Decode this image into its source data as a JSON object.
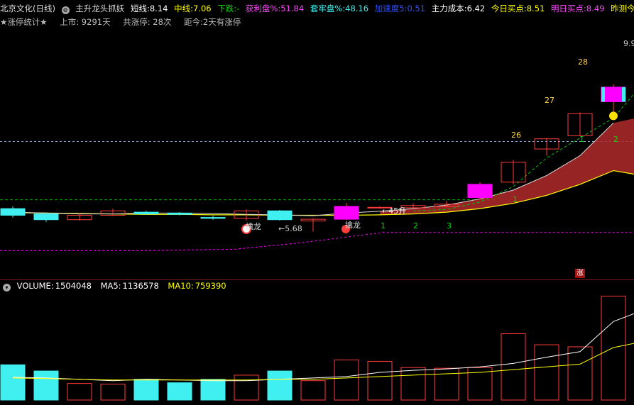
{
  "header": {
    "title": "北京文化(日线)",
    "indicator_name": "主升龙头抓妖",
    "short_label": "短线:",
    "short_value": "8.14",
    "mid_label": "中线:",
    "mid_value": "7.06",
    "fall_label": "下跌:",
    "fall_value": "-",
    "profit_label": "获利盘%:",
    "profit_value": "51.84",
    "trapped_label": "套牢盘%:",
    "trapped_value": "48.16",
    "accel_label": "加速度5:",
    "accel_value": "0.51",
    "cost_label": "主力成本:",
    "cost_value": "6.42",
    "today_buy_label": "今日买点:",
    "today_buy_value": "8.51",
    "tomorrow_buy_label": "明日买点:",
    "tomorrow_buy_value": "8.49",
    "yesterday_label": "昨测今日"
  },
  "stats": {
    "title": "★涨停统计★",
    "listed": "上市: 9291天",
    "limit_total": "共涨停: 28次",
    "since": "距今:2天有涨停"
  },
  "chart_labels": {
    "dragon1": "擒龙",
    "dragon2": "擒龙",
    "low_marker": "←5.68",
    "count_marker": "←45升",
    "top_marker": "9.9",
    "zhang": "涨",
    "waves": [
      "1",
      "2",
      "3",
      "1",
      "1",
      "2"
    ],
    "counts": [
      "26",
      "27",
      "28"
    ]
  },
  "volume": {
    "label": "VOLUME:",
    "value": "1504048",
    "ma5_label": "MA5:",
    "ma5_value": "1136578",
    "ma10_label": "MA10:",
    "ma10_value": "759390"
  },
  "colors": {
    "up": "#ff3b3b",
    "down": "#40f0f0",
    "magenta": "#ff00ff",
    "yellow": "#ffff00",
    "green": "#00e000",
    "fill": "#b02a2a"
  },
  "chart_data": {
    "type": "candlestick",
    "candles": [
      {
        "o": 6.2,
        "c": 6.05,
        "h": 6.25,
        "l": 6.0,
        "dir": "down"
      },
      {
        "o": 6.08,
        "c": 5.95,
        "h": 6.1,
        "l": 5.9,
        "dir": "down"
      },
      {
        "o": 5.95,
        "c": 6.05,
        "h": 6.1,
        "l": 5.93,
        "dir": "up"
      },
      {
        "o": 6.05,
        "c": 6.15,
        "h": 6.2,
        "l": 6.03,
        "dir": "up"
      },
      {
        "o": 6.12,
        "c": 6.08,
        "h": 6.15,
        "l": 6.06,
        "dir": "down"
      },
      {
        "o": 6.1,
        "c": 6.07,
        "h": 6.12,
        "l": 6.05,
        "dir": "down"
      },
      {
        "o": 6.0,
        "c": 5.98,
        "h": 6.04,
        "l": 5.95,
        "dir": "down"
      },
      {
        "o": 5.98,
        "c": 6.15,
        "h": 6.18,
        "l": 5.93,
        "dir": "up"
      },
      {
        "o": 6.15,
        "c": 5.95,
        "h": 6.17,
        "l": 5.93,
        "dir": "down"
      },
      {
        "o": 5.92,
        "c": 5.96,
        "h": 5.98,
        "l": 5.68,
        "dir": "up"
      },
      {
        "o": 5.96,
        "c": 6.25,
        "h": 6.33,
        "l": 5.94,
        "dir": "up"
      },
      {
        "o": 6.22,
        "c": 6.23,
        "h": 6.25,
        "l": 6.2,
        "dir": "up"
      },
      {
        "o": 6.22,
        "c": 6.27,
        "h": 6.32,
        "l": 6.2,
        "dir": "up"
      },
      {
        "o": 6.25,
        "c": 6.3,
        "h": 6.38,
        "l": 6.23,
        "dir": "up"
      },
      {
        "o": 6.45,
        "c": 6.75,
        "h": 6.8,
        "l": 6.4,
        "dir": "up"
      },
      {
        "o": 6.8,
        "c": 7.25,
        "h": 7.3,
        "l": 6.75,
        "dir": "up"
      },
      {
        "o": 7.55,
        "c": 7.78,
        "h": 7.8,
        "l": 7.4,
        "dir": "up"
      },
      {
        "o": 7.85,
        "c": 8.35,
        "h": 8.38,
        "l": 7.85,
        "dir": "up"
      },
      {
        "o": 8.62,
        "c": 8.95,
        "h": 9.02,
        "l": 8.3,
        "dir": "up"
      }
    ],
    "series": [
      {
        "name": "短线",
        "values": [
          6.12,
          6.1,
          6.08,
          6.08,
          6.1,
          6.1,
          6.09,
          6.07,
          6.06,
          6.04,
          6.1,
          6.14,
          6.2,
          6.28,
          6.42,
          6.62,
          6.95,
          7.4,
          8.14
        ]
      },
      {
        "name": "中线",
        "values": [
          6.11,
          6.1,
          6.09,
          6.08,
          6.07,
          6.07,
          6.06,
          6.06,
          6.05,
          6.05,
          6.05,
          6.06,
          6.08,
          6.12,
          6.2,
          6.32,
          6.5,
          6.75,
          7.06
        ]
      }
    ],
    "volume": [
      510000,
      420000,
      240000,
      230000,
      300000,
      250000,
      300000,
      360000,
      420000,
      280000,
      580000,
      560000,
      470000,
      460000,
      470000,
      960000,
      800000,
      770000,
      1504048
    ],
    "volume_ma5": [
      330000,
      320000,
      300000,
      280000,
      300000,
      290000,
      280000,
      280000,
      300000,
      320000,
      340000,
      400000,
      430000,
      450000,
      480000,
      530000,
      620000,
      700000,
      1136578
    ],
    "volume_ma10": [
      320000,
      310000,
      300000,
      290000,
      290000,
      290000,
      290000,
      290000,
      300000,
      300000,
      320000,
      340000,
      360000,
      380000,
      400000,
      440000,
      480000,
      520000,
      759390
    ]
  }
}
